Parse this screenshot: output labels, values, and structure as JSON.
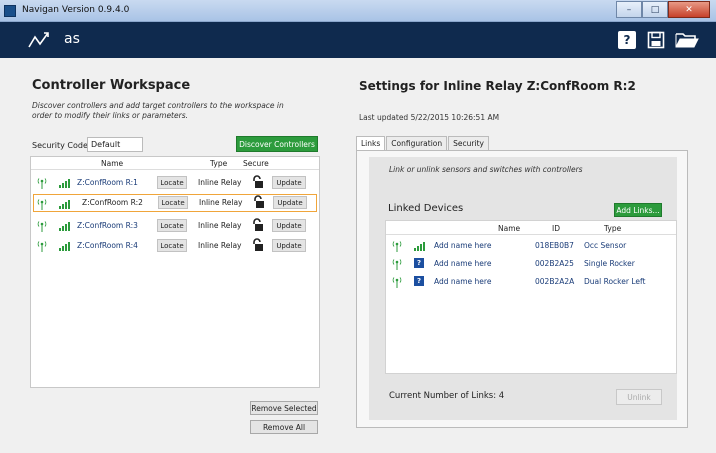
{
  "window": {
    "title": "Navigan Version 0.9.4.0"
  },
  "header": {
    "app_name": "as"
  },
  "left": {
    "title": "Controller Workspace",
    "description": "Discover controllers and add target controllers to the workspace in order to modify their links or parameters.",
    "security_label": "Security Code",
    "security_value": "Default",
    "discover_label": "Discover Controllers",
    "columns": {
      "name": "Name",
      "type": "Type",
      "secure": "Secure"
    },
    "controllers": [
      {
        "name": "Z:ConfRoom R:1",
        "locate": "Locate",
        "type": "Inline Relay",
        "update": "Update"
      },
      {
        "name": "Z:ConfRoom R:2",
        "locate": "Locate",
        "type": "Inline Relay",
        "update": "Update"
      },
      {
        "name": "Z:ConfRoom R:3",
        "locate": "Locate",
        "type": "Inline Relay",
        "update": "Update"
      },
      {
        "name": "Z:ConfRoom R:4",
        "locate": "Locate",
        "type": "Inline Relay",
        "update": "Update"
      }
    ],
    "remove_selected_label": "Remove Selected",
    "remove_all_label": "Remove All"
  },
  "right": {
    "title": "Settings for Inline Relay Z:ConfRoom R:2",
    "last_updated": "Last updated 5/22/2015 10:26:51 AM",
    "tabs": [
      "Links",
      "Configuration",
      "Security"
    ],
    "links_description": "Link or unlink sensors and switches with controllers",
    "linked_title": "Linked Devices",
    "add_links_label": "Add Links...",
    "columns": {
      "name": "Name",
      "id": "ID",
      "type": "Type"
    },
    "devices": [
      {
        "name": "Add name here",
        "id": "018EB0B7",
        "type": "Occ Sensor"
      },
      {
        "name": "Add name here",
        "id": "002B2A25",
        "type": "Single Rocker"
      },
      {
        "name": "Add name here",
        "id": "002B2A2A",
        "type": "Dual Rocker Left"
      }
    ],
    "count_text": "Current Number of Links: 4",
    "unlink_label": "Unlink"
  },
  "colors": {
    "header_bg": "#0f2a4e",
    "accent_green": "#2c9b3c",
    "selection": "#f0a53a",
    "link_text": "#1a3c78"
  }
}
